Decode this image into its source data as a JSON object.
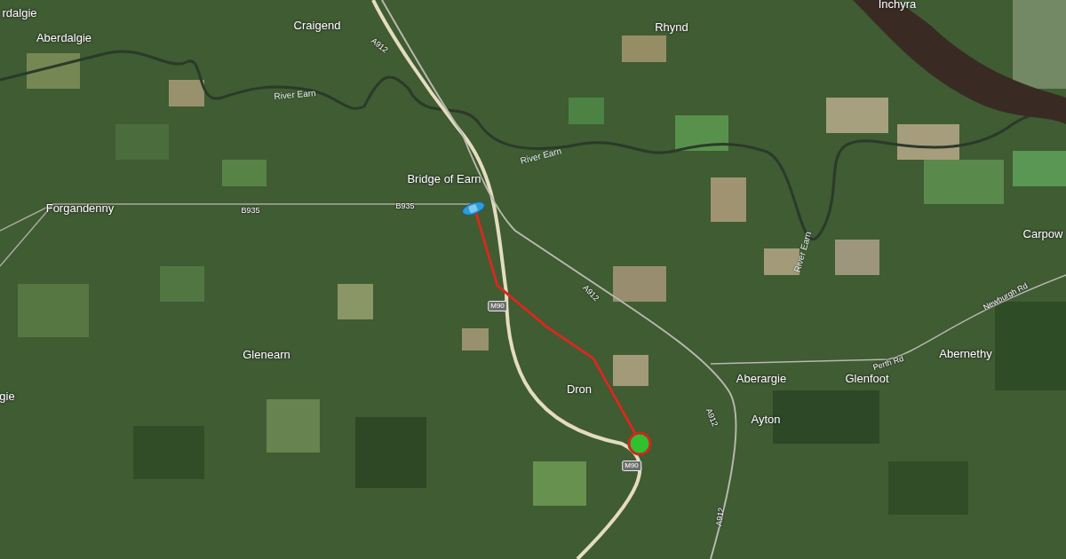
{
  "map": {
    "places": [
      {
        "name": "rdalgie",
        "kind": "place"
      },
      {
        "name": "Aberdalgie",
        "kind": "place"
      },
      {
        "name": "Craigend",
        "kind": "place"
      },
      {
        "name": "Rhynd",
        "kind": "place"
      },
      {
        "name": "Inchyra",
        "kind": "place"
      },
      {
        "name": "Bridge of Earn",
        "kind": "place"
      },
      {
        "name": "Forgandenny",
        "kind": "place"
      },
      {
        "name": "Carpow",
        "kind": "place"
      },
      {
        "name": "Glenearn",
        "kind": "place"
      },
      {
        "name": "Dron",
        "kind": "place"
      },
      {
        "name": "Abernethy",
        "kind": "place"
      },
      {
        "name": "Aberargie",
        "kind": "place"
      },
      {
        "name": "Glenfoot",
        "kind": "place"
      },
      {
        "name": "Ayton",
        "kind": "place"
      },
      {
        "name": "gie",
        "kind": "place"
      },
      {
        "name": "A912",
        "kind": "road"
      },
      {
        "name": "River Earn",
        "kind": "river"
      },
      {
        "name": "River Earn",
        "kind": "river"
      },
      {
        "name": "B935",
        "kind": "road"
      },
      {
        "name": "B935",
        "kind": "road"
      },
      {
        "name": "River Earn",
        "kind": "river"
      },
      {
        "name": "A912",
        "kind": "road"
      },
      {
        "name": "Newburgh Rd",
        "kind": "road"
      },
      {
        "name": "Perth Rd",
        "kind": "road"
      },
      {
        "name": "A912",
        "kind": "road"
      },
      {
        "name": "A912",
        "kind": "road"
      },
      {
        "name": "M90",
        "kind": "motorway"
      },
      {
        "name": "M90",
        "kind": "motorway"
      }
    ]
  }
}
